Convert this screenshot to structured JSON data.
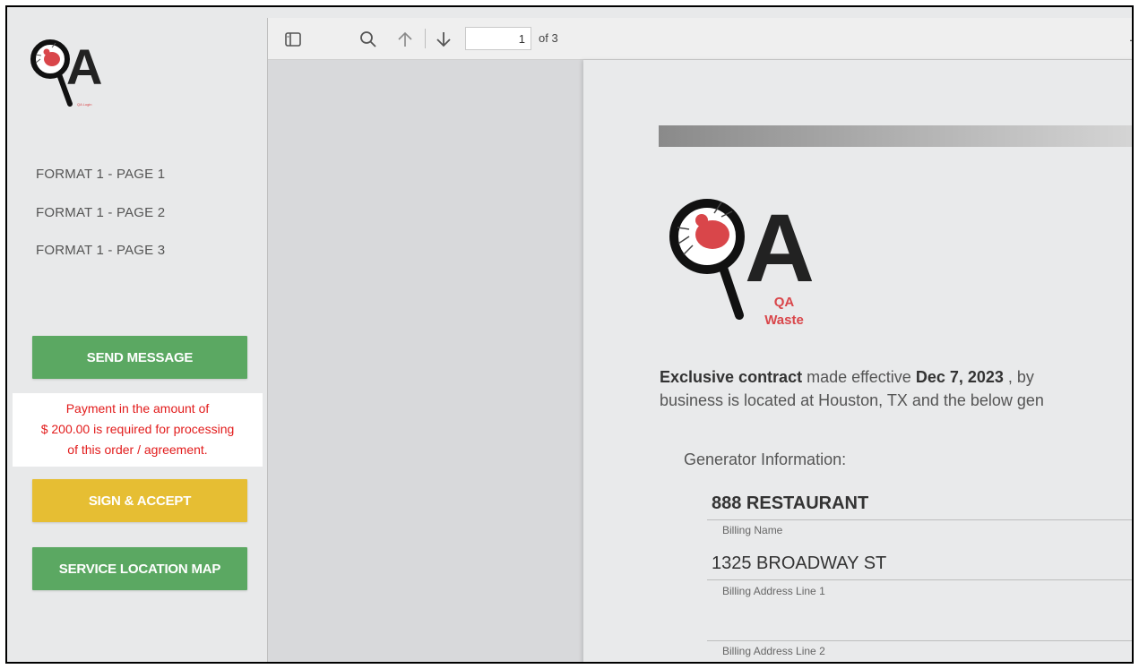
{
  "sidebar": {
    "logo_caption": "QA Login",
    "nav": [
      "FORMAT 1 - PAGE 1",
      "FORMAT 1 - PAGE 2",
      "FORMAT 1 - PAGE 3"
    ],
    "send_message_label": "SEND MESSAGE",
    "notice_lines": [
      "Payment in the amount of",
      "$ 200.00 is required for processing",
      "of this order / agreement."
    ],
    "sign_accept_label": "SIGN & ACCEPT",
    "service_map_label": "SERVICE LOCATION MAP"
  },
  "viewer": {
    "page_number": "1",
    "page_of": "of 3",
    "icons": [
      "sidebar-toggle-icon",
      "search-icon",
      "arrow-up-icon",
      "arrow-down-icon",
      "zoom-out-icon"
    ]
  },
  "document": {
    "logo_text": "A",
    "logo_caption_1": "QA",
    "logo_caption_2": "Waste",
    "contract": {
      "lead_bold": "Exclusive contract",
      "lead_text": " made effective ",
      "date": "Dec 7, 2023",
      "tail": "  , by",
      "line2": "business is located at Houston, TX and the below gen"
    },
    "generator_title": "Generator Information:",
    "billing_name": "888  RESTAURANT",
    "billing_name_label": "Billing Name",
    "address1": "1325 BROADWAY ST",
    "address1_label": "Billing Address Line 1",
    "address2_label": "Billing Address Line 2"
  },
  "colors": {
    "green": "#5ba862",
    "yellow": "#e6be33",
    "notice_red": "#e21b1b",
    "bug_red": "#d9464a"
  }
}
